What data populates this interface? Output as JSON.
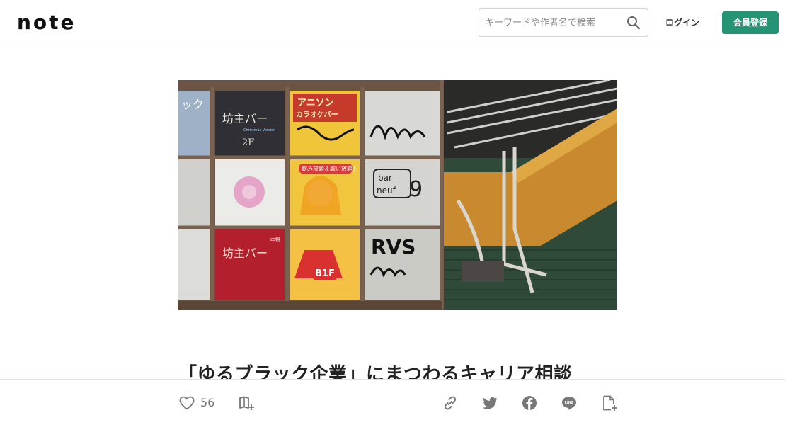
{
  "header": {
    "logo_text": "note",
    "search": {
      "placeholder": "キーワードや作者名で検索",
      "value": ""
    },
    "login_label": "ログイン",
    "signup_label": "会員登録",
    "brand_color": "#249475"
  },
  "hero": {
    "sign_texts": {
      "partial_katakana": "ック",
      "bar_name": "坊主バー",
      "bar_sub": "Christmas Version",
      "floor_2f": "2F",
      "anisong_line1": "アニソン",
      "anisong_line2": "カラオケバー",
      "anisong_banner": "飲み放題＆歌い放題♪",
      "floor_b1f": "B1F",
      "nakano": "中野",
      "bar_neuf_line1": "bar",
      "bar_neuf_line2": "neuf",
      "bar_neuf_number": "9",
      "graffiti_rvs": "RVS"
    }
  },
  "article": {
    "title": "「ゆるブラック企業」にまつわるキャリア相談"
  },
  "actions": {
    "like_count": "56",
    "icons": [
      "heart-icon",
      "magazine-add-icon",
      "link-icon",
      "twitter-icon",
      "facebook-icon",
      "line-icon",
      "note-embed-icon"
    ]
  }
}
